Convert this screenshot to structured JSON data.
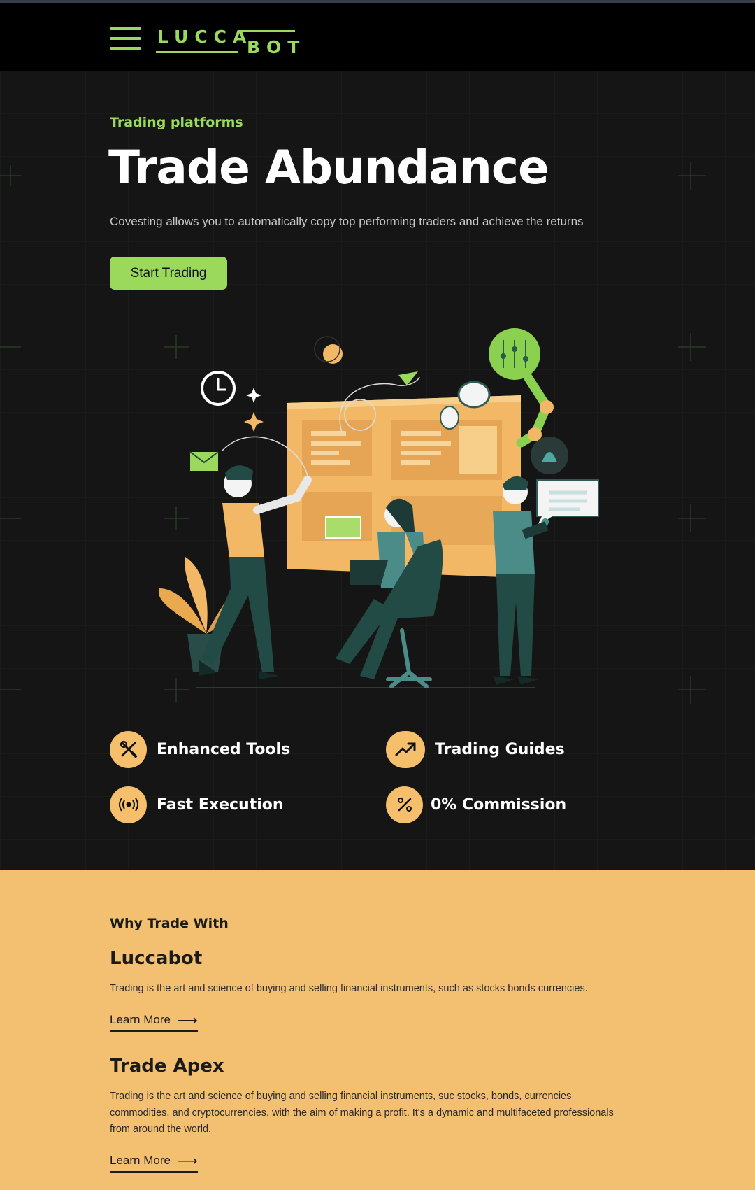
{
  "header": {
    "menu_icon": "hamburger-menu-icon",
    "logo_top": "LUCCA",
    "logo_bottom": "BOT",
    "accent": "#9bd95c"
  },
  "hero": {
    "eyebrow": "Trading platforms",
    "title": "Trade Abundance",
    "subtitle": "Covesting allows you to automatically copy top performing traders and achieve the returns",
    "cta_label": "Start Trading",
    "background": "#151515"
  },
  "features": [
    {
      "label": "Enhanced Tools",
      "icon": "tools-icon"
    },
    {
      "label": "Trading Guides",
      "icon": "trending-up-icon"
    },
    {
      "label": "Fast Execution",
      "icon": "broadcast-icon"
    },
    {
      "label": "0% Commission",
      "icon": "percent-icon"
    }
  ],
  "why": {
    "kicker": "Why Trade With",
    "background": "#f2c070",
    "blocks": [
      {
        "heading": "Luccabot",
        "text": "Trading is the art and science of buying and selling financial instruments, such as stocks bonds currencies.",
        "link": "Learn More"
      },
      {
        "heading": "Trade Apex",
        "text": "Trading is the art and science of buying and selling financial instruments, suc stocks, bonds, currencies commodities, and cryptocurrencies, with the aim of making a profit. It's a dynamic and multifaceted professionals from around the world.",
        "link": "Learn More"
      }
    ]
  }
}
